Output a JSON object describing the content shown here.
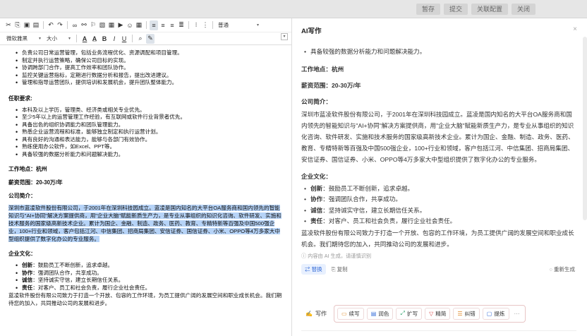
{
  "topbar": {
    "buttons": [
      "暂存",
      "提交",
      "关联配置",
      "关闭"
    ]
  },
  "toolbar": {
    "font_size": "普通",
    "font_family": "微软雅黑",
    "size": "大小",
    "arrow": "▾"
  },
  "doc": {
    "list1": [
      "负责公司日常运营管理，包括业务流程优化、资源调配和项目管理。",
      "制定并执行运营策略，确保公司目标的实现。",
      "协调跨部门合作，提高工作效率和团队协作。",
      "监控关键运营指标，定期进行数据分析和报告，提出改进建议。",
      "管理和指导运营团队，提供培训和发展机会，提升团队整体能力。"
    ],
    "req_title": "任职要求:",
    "list2": [
      "本科及以上学历，管理类、经济类或相关专业优先。",
      "至少5年以上的运营管理工作经验，有互联网或软件行业背景者优先。",
      "具备出色的组织协调能力和团队管理能力。",
      "熟悉企业运营流程和标准，能够独立制定和执行运营计划。",
      "具有良好的沟通和表达能力，能够与各部门有效协作。",
      "熟练使用办公软件，如Excel、PPT等。",
      "具备较强的数据分析能力和问题解决能力。"
    ],
    "location": "工作地点：杭州",
    "salary": "薪资范围：20-30万/年",
    "intro_title": "公司简介：",
    "intro": "深圳市蓝凌软件股份有限公司，于2001年在深圳科技园成立。蓝凌是国内知名的大平台OA服务商和国内领先的智能知识与\"AI+协同\"解决方案提供商，用\"企业大脑\"赋能新质生产力，是专业从事组织的知识化咨询、软件研发、实施和技术服务的国家级高新技术企业。累计为国企、金融、制造、政务、医药、教育、专精特新等百强及中国500强企业，100+行业和领域，客户包括江河、中信集团、招商局集团、安信证券、国信证券、小米、OPPO等4万多家大中型组织提供了数字化办公的专业服务。",
    "culture_title": "企业文化：",
    "culture": [
      {
        "k": "创新",
        "v": "：鼓励员工不断创新，追求卓越。"
      },
      {
        "k": "协作",
        "v": "：强调团队合作，共享成功。"
      },
      {
        "k": "诚信",
        "v": "：坚持诚实守信，建立长期信任关系。"
      },
      {
        "k": "责任",
        "v": "：对客户、员工和社会负责，履行企业社会责任。"
      }
    ],
    "closing": "蓝凌软件股份有限公司致力于打造一个开放、包容的工作环境，为员工提供广阔的发展空间和职业成长机会。我们期待您的加入，共同推动公司的发展和进步。"
  },
  "panel": {
    "title": "AI写作",
    "close": "×",
    "bullet_top": "具备较强的数据分析能力和问题解决能力。",
    "location": "工作地点：杭州",
    "salary": "薪资范围：20-30万/年",
    "intro_title": "公司简介：",
    "intro": "深圳市蓝凌软件股份有限公司，于2001年在深圳科技园成立。蓝凌是国内知名的大平台OA服务商和国内领先的智能知识与\"AI+协同\"解决方案提供商，用\"企业大脑\"赋能新质生产力，是专业从事组织的知识化咨询、软件研发、实施和技术服务的国家级高新技术企业。累计为国企、金融、制造、政务、医药、教育、专精特新等百强及中国500强企业，100+行业和领域，客户包括江河、中信集团、招商局集团、安信证券、国信证券、小米、OPPO等4万多家大中型组织提供了数字化办公的专业服务。",
    "culture_title": "企业文化：",
    "culture": [
      {
        "k": "创新",
        "v": "：鼓励员工不断创新，追求卓越。"
      },
      {
        "k": "协作",
        "v": "：强调团队合作，共享成功。"
      },
      {
        "k": "诚信",
        "v": "：坚持诚实守信，建立长期信任关系。"
      },
      {
        "k": "责任",
        "v": "：对客户、员工和社会负责，履行企业社会责任。"
      }
    ],
    "closing": "蓝凌软件股份有限公司致力于打造一个开放、包容的工作环境，为员工提供广阔的发展空间和职业成长机会。我们期待您的加入，共同推动公司的发展和进步。",
    "note": "ⓘ 内容由 AI 生成，请谨慎识别",
    "replace": "⇄ 替换",
    "copy": "⎘ 复制",
    "regen": "◌ 重新生成",
    "write": "写作",
    "tools": [
      {
        "icon": "▭",
        "label": "续写",
        "color": "#e08a2b",
        "name": "continue"
      },
      {
        "icon": "▤",
        "label": "润色",
        "color": "#3a6fd8",
        "name": "polish"
      },
      {
        "icon": "⤢",
        "label": "扩写",
        "color": "#2aa36b",
        "name": "expand"
      },
      {
        "icon": "▽",
        "label": "精简",
        "color": "#d94d4d",
        "name": "simplify"
      },
      {
        "icon": "☰",
        "label": "纠错",
        "color": "#e08a2b",
        "name": "correct"
      },
      {
        "icon": "▢",
        "label": "提炼",
        "color": "#3a6fd8",
        "name": "extract"
      }
    ],
    "more": "···"
  }
}
